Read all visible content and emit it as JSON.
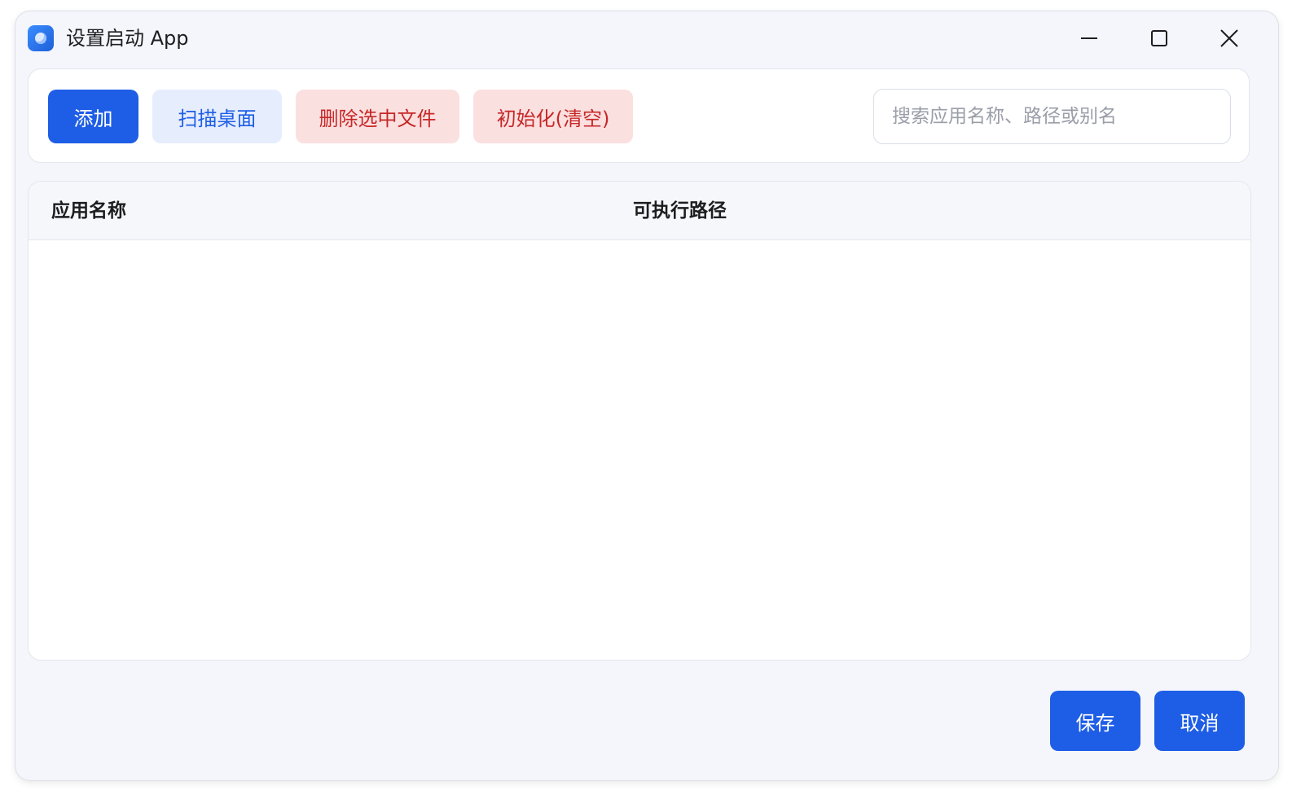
{
  "window": {
    "title": "设置启动 App",
    "icon": "app-icon"
  },
  "toolbar": {
    "add_label": "添加",
    "scan_label": "扫描桌面",
    "delete_label": "删除选中文件",
    "init_label": "初始化(清空)",
    "search_placeholder": "搜索应用名称、路径或别名",
    "search_value": ""
  },
  "table": {
    "columns": [
      "应用名称",
      "可执行路径"
    ],
    "rows": []
  },
  "footer": {
    "save_label": "保存",
    "cancel_label": "取消"
  },
  "colors": {
    "primary": "#1e5ee6",
    "secondary_bg": "#e6edfd",
    "danger_bg": "#fbe0e0",
    "danger_text": "#c62828"
  }
}
